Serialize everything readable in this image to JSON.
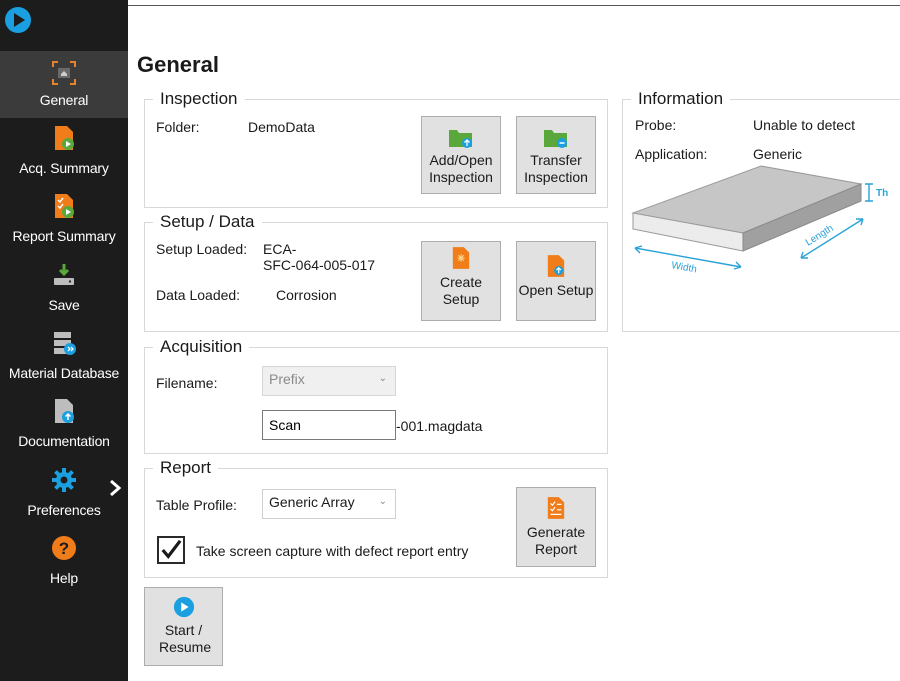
{
  "sidebar": {
    "items": [
      {
        "label": "General",
        "icon": "home-frame-icon"
      },
      {
        "label": "Acq. Summary",
        "icon": "acq-summary-icon"
      },
      {
        "label": "Report Summary",
        "icon": "report-summary-icon"
      },
      {
        "label": "Save",
        "icon": "save-icon"
      },
      {
        "label": "Material Database",
        "icon": "material-database-icon"
      },
      {
        "label": "Documentation",
        "icon": "documentation-icon"
      },
      {
        "label": "Preferences",
        "icon": "gear-icon"
      },
      {
        "label": "Help",
        "icon": "help-icon"
      }
    ]
  },
  "main": {
    "title": "General",
    "inspection": {
      "title": "Inspection",
      "folder_label": "Folder:",
      "folder_value": "DemoData",
      "add_open_label": "Add/Open Inspection",
      "transfer_label": "Transfer Inspection"
    },
    "setup": {
      "title": "Setup / Data",
      "setup_loaded_label": "Setup Loaded:",
      "setup_loaded_value_1": "ECA-",
      "setup_loaded_value_2": "SFC-064-005-017",
      "data_loaded_label": "Data Loaded:",
      "data_loaded_value": "Corrosion",
      "create_setup_label": "Create Setup",
      "open_setup_label": "Open Setup"
    },
    "acquisition": {
      "title": "Acquisition",
      "filename_label": "Filename:",
      "prefix_value": "Prefix",
      "scan_value": "Scan",
      "suffix": "-001.magdata"
    },
    "report": {
      "title": "Report",
      "table_profile_label": "Table Profile:",
      "table_profile_value": "Generic Array",
      "screen_capture_label": "Take screen capture with defect report entry",
      "screen_capture_checked": true,
      "generate_label": "Generate Report"
    },
    "start_resume_label": "Start / Resume"
  },
  "information": {
    "title": "Information",
    "probe_label": "Probe:",
    "probe_value": "Unable to detect",
    "application_label": "Application:",
    "application_value": "Generic",
    "diagram": {
      "width": "Width",
      "length": "Length",
      "thickness": "Th"
    }
  },
  "colors": {
    "sidebar_bg": "#1c1c1c",
    "accent_blue": "#0a84c6",
    "orange": "#f07d1a",
    "green": "#5aa83b",
    "dim_blue": "#2aa3d8"
  }
}
